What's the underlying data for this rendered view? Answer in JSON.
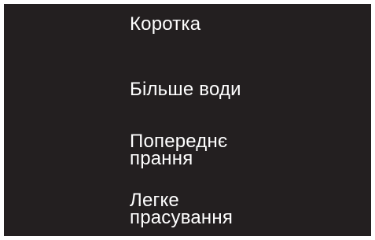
{
  "menu": {
    "items": [
      {
        "lines": [
          "Коротка"
        ]
      },
      {
        "lines": [
          "Більше води"
        ]
      },
      {
        "lines": [
          "Попереднє",
          "прання"
        ]
      },
      {
        "lines": [
          "Легке",
          "прасування"
        ]
      }
    ]
  },
  "colors": {
    "background": "#231f20",
    "text": "#ffffff",
    "frame": "#ffffff"
  }
}
